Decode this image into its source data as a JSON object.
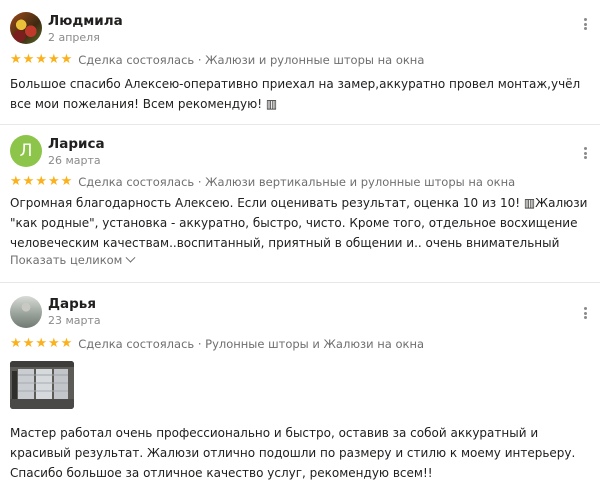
{
  "reviews": [
    {
      "author": "Людмила",
      "date": "2 апреля",
      "rating": 5,
      "meta": "Сделка состоялась · Жалюзи и рулонные шторы на окна",
      "text": "Большое спасибо Алексею-оперативно приехал на замер,аккуратно провел монтаж,учёл все мои пожелания! Всем рекомендую! ▥"
    },
    {
      "author": "Лариса",
      "avatar_letter": "Л",
      "date": "26 марта",
      "rating": 5,
      "meta": "Сделка состоялась · Жалюзи вертикальные и рулонные шторы на окна",
      "text": "Огромная благодарность Алексею. Если оценивать результат, оценка 10 из 10! ▥Жалюзи \"как родные\", установка - аккуратно, быстро, чисто. Кроме того, отдельное восхищение человеческим качествам..воспитанный, приятный в общении и.. очень внимательный Человек. Узнав, что у меня…",
      "expand_label": "Показать целиком"
    },
    {
      "author": "Дарья",
      "date": "23 марта",
      "rating": 5,
      "meta": "Сделка состоялась · Рулонные шторы и Жалюзи на окна",
      "text": "Мастер работал очень профессионально и быстро, оставив за собой аккуратный и красивый результат. Жалюзи отлично подошли по размеру и стилю к моему интерьеру. Спасибо большое за отличное качество услуг, рекомендую всем!!"
    }
  ],
  "colors": {
    "star": "#fbb11c",
    "avatar_letter_bg": "#8dc44a"
  },
  "icons": {
    "star": "star-icon",
    "more": "more-vertical-icon",
    "expand": "chevron-down-icon"
  }
}
